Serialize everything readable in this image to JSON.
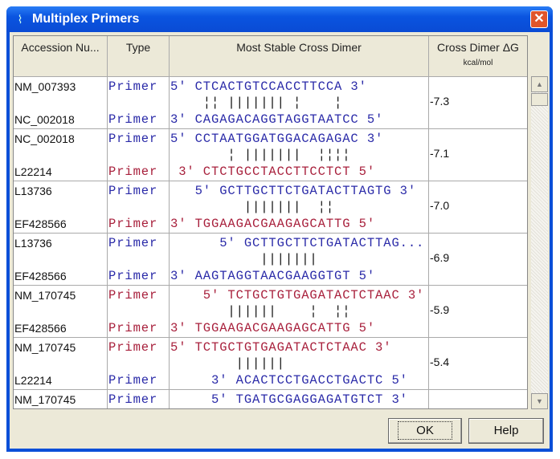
{
  "window": {
    "title": "Multiplex Primers",
    "close": "✕",
    "icon": "dna-icon"
  },
  "columns": [
    "Accession Nu...",
    "Type",
    "Most Stable Cross Dimer",
    "Cross Dimer ΔG"
  ],
  "column_sub": "kcal/mol",
  "colors": {
    "blue": "#2a2aa8",
    "red": "#a8203c"
  },
  "rows": [
    {
      "dg": "-7.3",
      "top": {
        "acc": "NM_007393",
        "type": "Primer",
        "color": "blue",
        "seq": "5' CTCACTGTCCACCTTCCA 3'"
      },
      "bars": "    ¦¦ ||||||| ¦    ¦",
      "bottom": {
        "acc": "NC_002018",
        "type": "Primer",
        "color": "blue",
        "seq": "3' CAGAGACAGGTAGGTAATCC 5'"
      }
    },
    {
      "dg": "-7.1",
      "top": {
        "acc": "NC_002018",
        "type": "Primer",
        "color": "blue",
        "seq": "5' CCTAATGGATGGACAGAGAC 3'"
      },
      "bars": "       ¦ |||||||  ¦¦¦¦",
      "bottom": {
        "acc": "L22214",
        "type": "Primer",
        "color": "red",
        "seq": " 3' CTCTGCCTACCTTCCTCT 5'"
      }
    },
    {
      "dg": "-7.0",
      "top": {
        "acc": "L13736",
        "type": "Primer",
        "color": "blue",
        "seq": "   5' GCTTGCTTCTGATACTTAGTG 3'"
      },
      "bars": "         |||||||  ¦¦",
      "bottom": {
        "acc": "EF428566",
        "type": "Primer",
        "color": "red",
        "seq": "3' TGGAAGACGAAGAGCATTG 5'"
      }
    },
    {
      "dg": "-6.9",
      "top": {
        "acc": "L13736",
        "type": "Primer",
        "color": "blue",
        "seq": "      5' GCTTGCTTCTGATACTTAG..."
      },
      "bars": "           |||||||",
      "bottom": {
        "acc": "EF428566",
        "type": "Primer",
        "color": "blue",
        "seq": "3' AAGTAGGTAACGAAGGTGT 5'"
      }
    },
    {
      "dg": "-5.9",
      "top": {
        "acc": "NM_170745",
        "type": "Primer",
        "color": "red",
        "seq": "    5' TCTGCTGTGAGATACTCTAAC 3'"
      },
      "bars": "       ||||||    ¦  ¦¦",
      "bottom": {
        "acc": "EF428566",
        "type": "Primer",
        "color": "red",
        "seq": "3' TGGAAGACGAAGAGCATTG 5'"
      }
    },
    {
      "dg": "-5.4",
      "top": {
        "acc": "NM_170745",
        "type": "Primer",
        "color": "red",
        "seq": "5' TCTGCTGTGAGATACTCTAAC 3'"
      },
      "bars": "        ||||||",
      "bottom": {
        "acc": "L22214",
        "type": "Primer",
        "color": "blue",
        "seq": "     3' ACACTCCTGACCTGACTC 5'"
      }
    },
    {
      "dg": "",
      "top": {
        "acc": "NM_170745",
        "type": "Primer",
        "color": "blue",
        "seq": "     5' TGATGCGAGGAGATGTCT 3'"
      },
      "bars": "",
      "bottom": null
    }
  ],
  "buttons": {
    "ok": "OK",
    "help": "Help"
  }
}
